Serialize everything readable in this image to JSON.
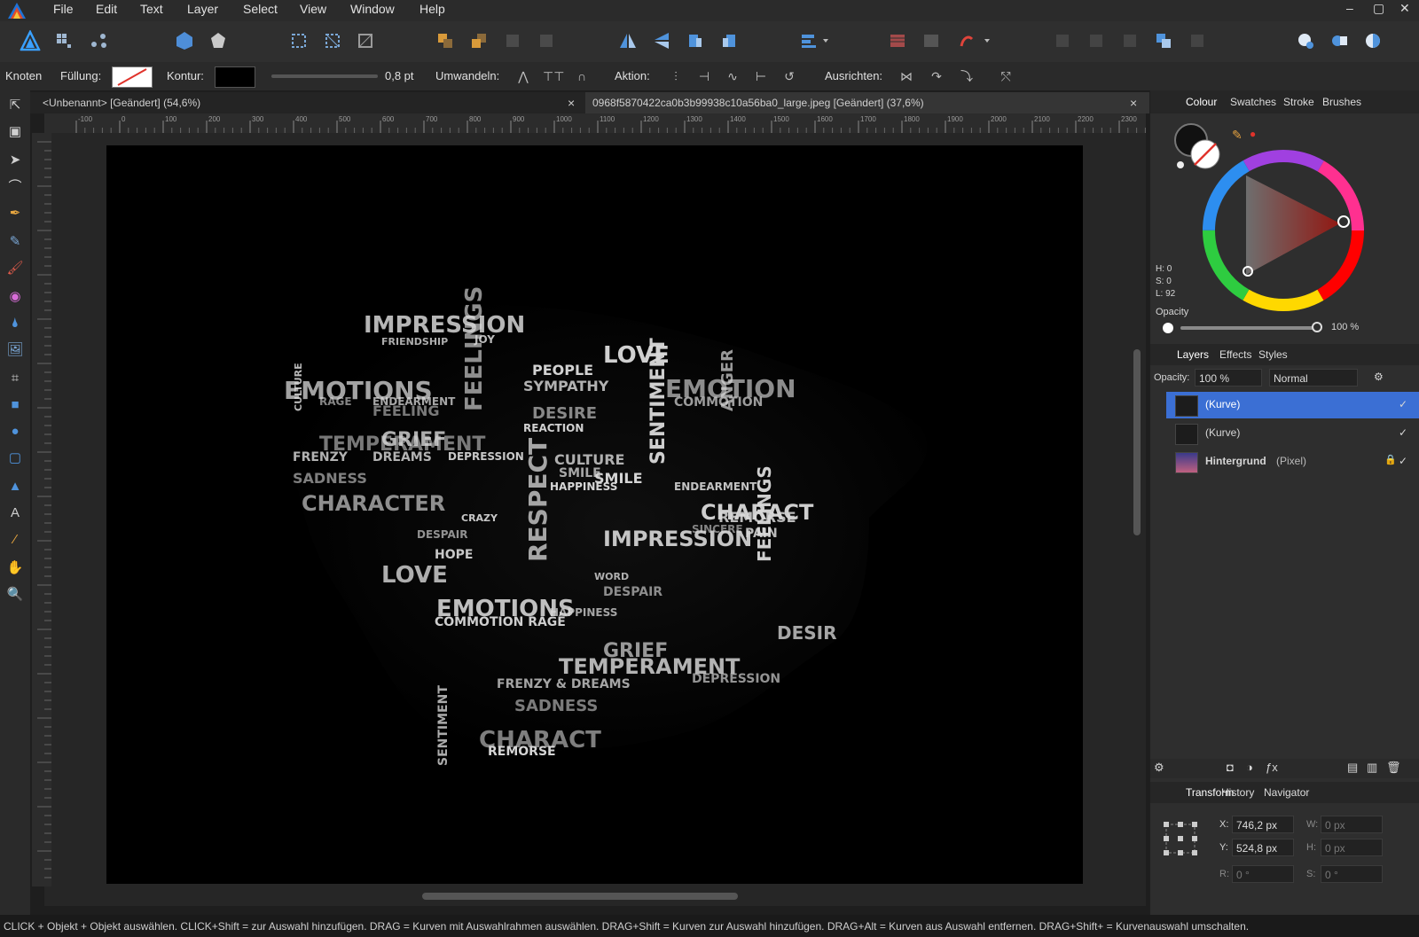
{
  "menubar": {
    "items": [
      "File",
      "Edit",
      "Text",
      "Layer",
      "Select",
      "View",
      "Window",
      "Help"
    ]
  },
  "contextbar": {
    "mode_label": "Knoten",
    "fill_label": "Füllung:",
    "stroke_label": "Kontur:",
    "stroke_width": "0,8 pt",
    "convert_label": "Umwandeln:",
    "action_label": "Aktion:",
    "align_label": "Ausrichten:"
  },
  "doctabs": {
    "tab1": "<Unbenannt> [Geändert] (54,6%)",
    "tab2": "0968f5870422ca0b3b99938c10a56ba0_large.jpeg [Geändert] (37,6%)"
  },
  "ruler": {
    "h_ticks": [
      "-100",
      "0",
      "100",
      "200",
      "300",
      "400",
      "500",
      "600",
      "700",
      "800",
      "900",
      "1000",
      "1100",
      "1200",
      "1300",
      "1400",
      "1500",
      "1600",
      "1700",
      "1800",
      "1900",
      "2000",
      "2100",
      "2200",
      "2300"
    ]
  },
  "colour_panel": {
    "tabs": [
      "Colour",
      "Swatches",
      "Stroke",
      "Brushes"
    ],
    "h": "H: 0",
    "s": "S: 0",
    "l": "L: 92",
    "opacity_label": "Opacity",
    "opacity_value": "100 %"
  },
  "layers_panel": {
    "tabs": [
      "Layers",
      "Effects",
      "Styles"
    ],
    "opacity_label": "Opacity:",
    "opacity_value": "100 %",
    "blend_mode": "Normal",
    "layers": [
      {
        "name": "(Kurve)",
        "bold": false,
        "selected": true
      },
      {
        "name": "(Kurve)",
        "bold": false,
        "selected": false
      },
      {
        "name": "Hintergrund",
        "suffix": "(Pixel)",
        "bold": true,
        "selected": false
      }
    ]
  },
  "transform_panel": {
    "tabs": [
      "Transform",
      "History",
      "Navigator"
    ],
    "x_label": "X:",
    "x_value": "746,2 px",
    "y_label": "Y:",
    "y_value": "524,8 px",
    "w_label": "W:",
    "w_value": "0 px",
    "h_label": "H:",
    "h_value": "0 px",
    "r_label": "R:",
    "r_value": "0 °",
    "s_label": "S:",
    "s_value": "0 °"
  },
  "statusbar": {
    "text": "CLICK + Objekt + Objekt auswählen. CLICK+Shift = zur Auswahl hinzufügen. DRAG = Kurven mit Auswahlrahmen auswählen. DRAG+Shift = Kurven zur Auswahl hinzufügen. DRAG+Alt = Kurven aus Auswahl entfernen. DRAG+Shift+ = Kurvenauswahl umschalten."
  },
  "artwork": {
    "words": [
      "IMPRESSION",
      "FRIENDSHIP",
      "JOY",
      "LOVE",
      "EMOTIONS",
      "EMOTION",
      "FEELINGS",
      "SYMPATHY",
      "PEOPLE",
      "DESIRE",
      "RAGE",
      "ENDEARMENT",
      "FEELING",
      "TEMPERAMENT",
      "COMMOTION",
      "CULTURE",
      "HAPPINESS",
      "REACTION",
      "ANGER",
      "FRENZY",
      "DREAMS",
      "SADNESS",
      "DEPRESSION",
      "SMILE",
      "RESPECT",
      "SENTIMENT",
      "CHARACTER",
      "REMORSE",
      "GRIEF",
      "CRAZY",
      "DESPAIR",
      "HOPE",
      "SINCERE",
      "PAIN",
      "WORD",
      "CHARACT",
      "REMORSE"
    ],
    "colors": {
      "text": "#d9d9d9",
      "canvas": "#000000",
      "accent": "#3b6fd4"
    }
  },
  "colors": {
    "selection": "#3b6fd4",
    "panel": "#2e2e2e",
    "brand": "#2a7fd4"
  }
}
